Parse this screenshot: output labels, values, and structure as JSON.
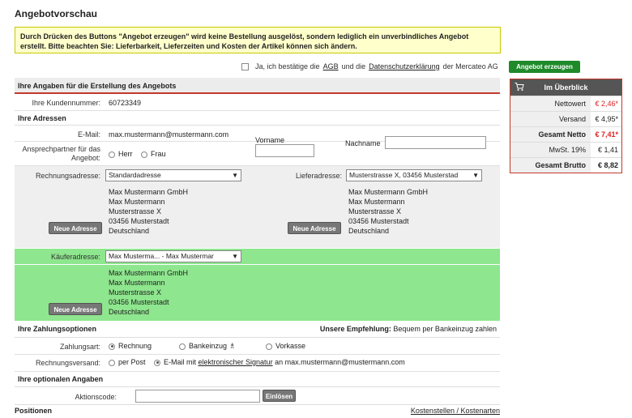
{
  "page": {
    "title": "Angebotvorschau"
  },
  "notice": "Durch Drücken des Buttons \"Angebot erzeugen\" wird keine Bestellung ausgelöst, sondern lediglich ein unverbindliches Angebot erstellt. Bitte beachten Sie: Lieferbarkeit, Lieferzeiten und Kosten der Artikel können sich ändern.",
  "agb": {
    "prefix": "Ja, ich bestätige die",
    "agb_link": "AGB",
    "middle": "und die",
    "privacy_link": "Datenschutzerklärung",
    "suffix": "der Mercateo AG"
  },
  "create_offer_button": "Angebot erzeugen",
  "section_main": "Ihre Angaben für die Erstellung des Angebots",
  "customer": {
    "label": "Ihre Kundennummer:",
    "value": "60723349"
  },
  "addresses": {
    "title": "Ihre Adressen",
    "email_label": "E-Mail:",
    "email_value": "max.mustermann@mustermann.com",
    "contact_label": "Ansprechpartner für das Angebot:",
    "herr": "Herr",
    "frau": "Frau",
    "vorname": "Vorname",
    "nachname": "Nachname",
    "billing_label": "Rechnungsadresse:",
    "billing_value": "Standardadresse",
    "delivery_label": "Lieferadresse:",
    "delivery_value": "Musterstrasse X, 03456 Musterstad",
    "new_address": "Neue Adresse",
    "billing_lines": [
      "Max Mustermann GmbH",
      "Max Mustermann",
      "Musterstrasse X",
      "03456 Musterstadt",
      "Deutschland"
    ],
    "delivery_lines": [
      "Max Mustermann GmbH",
      "Max Mustermann",
      "Musterstrasse X",
      "03456 Musterstadt",
      "Deutschland"
    ],
    "buyer_label": "Käuferadresse:",
    "buyer_value": "Max Musterma... - Max Mustermar",
    "buyer_lines": [
      "Max Mustermann GmbH",
      "Max Mustermann",
      "Musterstrasse X",
      "03456 Musterstadt",
      "Deutschland"
    ]
  },
  "payment": {
    "title": "Ihre Zahlungsoptionen",
    "recommendation_label": "Unsere Empfehlung:",
    "recommendation_value": "Bequem per Bankeinzug zahlen",
    "method_label": "Zahlungsart:",
    "rechnung": "Rechnung",
    "bankeinzug": "Bankeinzug",
    "vorkasse": "Vorkasse",
    "dispatch_label": "Rechnungsversand:",
    "post": "per Post",
    "email_prefix": "E-Mail mit",
    "signature_link": "elektronischer Signatur",
    "email_suffix": "an max.mustermann@mustermann.com"
  },
  "optional": {
    "title": "Ihre optionalen Angaben",
    "action_label": "Aktionscode:",
    "redeem": "Einlösen"
  },
  "positions": {
    "title": "Positionen",
    "cost_link": "Kostenstellen / Kostenarten"
  },
  "overview": {
    "title": "Im Überblick",
    "rows": [
      {
        "label": "Nettowert",
        "value": "€ 2,46*"
      },
      {
        "label": "Versand",
        "value": "€ 4,95*"
      },
      {
        "label": "Gesamt Netto",
        "value": "€ 7,41*"
      },
      {
        "label": "MwSt. 19%",
        "value": "€ 1,41"
      },
      {
        "label": "Gesamt Brutto",
        "value": "€ 8,82"
      }
    ]
  },
  "colors": {
    "accent_green": "#1e8a2a",
    "highlight_green": "#8ee68e",
    "red": "#c23a2a",
    "notice_bg": "#ffffcc"
  }
}
